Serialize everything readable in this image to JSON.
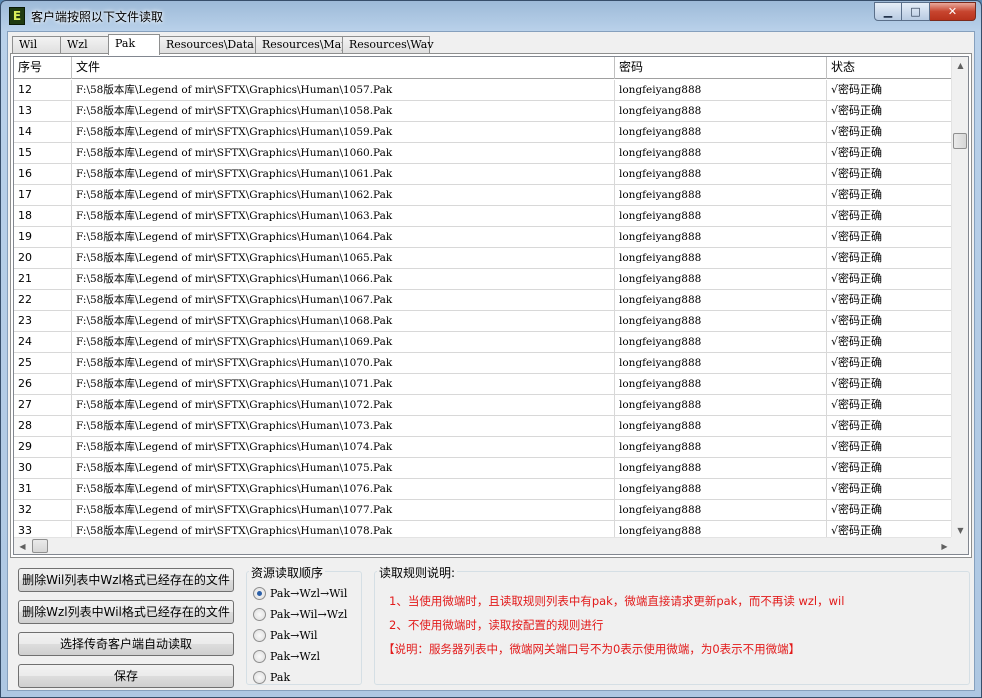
{
  "window": {
    "title": "客户端按照以下文件读取",
    "icon_letter": "E",
    "minimize_glyph": "▁",
    "maximize_glyph": "□",
    "close_glyph": "✕"
  },
  "tabs": [
    {
      "label": "Wil"
    },
    {
      "label": "Wzl"
    },
    {
      "label": "Pak"
    },
    {
      "label": "Resources\\Data"
    },
    {
      "label": "Resources\\Map"
    },
    {
      "label": "Resources\\Wav"
    }
  ],
  "table": {
    "columns": [
      "序号",
      "文件",
      "密码",
      "状态"
    ],
    "rows": [
      {
        "id": "12",
        "file": "F:\\58版本库\\Legend of mir\\SFTX\\Graphics\\Human\\1057.Pak",
        "password": "longfeiyang888",
        "status": "√密码正确"
      },
      {
        "id": "13",
        "file": "F:\\58版本库\\Legend of mir\\SFTX\\Graphics\\Human\\1058.Pak",
        "password": "longfeiyang888",
        "status": "√密码正确"
      },
      {
        "id": "14",
        "file": "F:\\58版本库\\Legend of mir\\SFTX\\Graphics\\Human\\1059.Pak",
        "password": "longfeiyang888",
        "status": "√密码正确"
      },
      {
        "id": "15",
        "file": "F:\\58版本库\\Legend of mir\\SFTX\\Graphics\\Human\\1060.Pak",
        "password": "longfeiyang888",
        "status": "√密码正确"
      },
      {
        "id": "16",
        "file": "F:\\58版本库\\Legend of mir\\SFTX\\Graphics\\Human\\1061.Pak",
        "password": "longfeiyang888",
        "status": "√密码正确"
      },
      {
        "id": "17",
        "file": "F:\\58版本库\\Legend of mir\\SFTX\\Graphics\\Human\\1062.Pak",
        "password": "longfeiyang888",
        "status": "√密码正确"
      },
      {
        "id": "18",
        "file": "F:\\58版本库\\Legend of mir\\SFTX\\Graphics\\Human\\1063.Pak",
        "password": "longfeiyang888",
        "status": "√密码正确"
      },
      {
        "id": "19",
        "file": "F:\\58版本库\\Legend of mir\\SFTX\\Graphics\\Human\\1064.Pak",
        "password": "longfeiyang888",
        "status": "√密码正确"
      },
      {
        "id": "20",
        "file": "F:\\58版本库\\Legend of mir\\SFTX\\Graphics\\Human\\1065.Pak",
        "password": "longfeiyang888",
        "status": "√密码正确"
      },
      {
        "id": "21",
        "file": "F:\\58版本库\\Legend of mir\\SFTX\\Graphics\\Human\\1066.Pak",
        "password": "longfeiyang888",
        "status": "√密码正确"
      },
      {
        "id": "22",
        "file": "F:\\58版本库\\Legend of mir\\SFTX\\Graphics\\Human\\1067.Pak",
        "password": "longfeiyang888",
        "status": "√密码正确"
      },
      {
        "id": "23",
        "file": "F:\\58版本库\\Legend of mir\\SFTX\\Graphics\\Human\\1068.Pak",
        "password": "longfeiyang888",
        "status": "√密码正确"
      },
      {
        "id": "24",
        "file": "F:\\58版本库\\Legend of mir\\SFTX\\Graphics\\Human\\1069.Pak",
        "password": "longfeiyang888",
        "status": "√密码正确"
      },
      {
        "id": "25",
        "file": "F:\\58版本库\\Legend of mir\\SFTX\\Graphics\\Human\\1070.Pak",
        "password": "longfeiyang888",
        "status": "√密码正确"
      },
      {
        "id": "26",
        "file": "F:\\58版本库\\Legend of mir\\SFTX\\Graphics\\Human\\1071.Pak",
        "password": "longfeiyang888",
        "status": "√密码正确"
      },
      {
        "id": "27",
        "file": "F:\\58版本库\\Legend of mir\\SFTX\\Graphics\\Human\\1072.Pak",
        "password": "longfeiyang888",
        "status": "√密码正确"
      },
      {
        "id": "28",
        "file": "F:\\58版本库\\Legend of mir\\SFTX\\Graphics\\Human\\1073.Pak",
        "password": "longfeiyang888",
        "status": "√密码正确"
      },
      {
        "id": "29",
        "file": "F:\\58版本库\\Legend of mir\\SFTX\\Graphics\\Human\\1074.Pak",
        "password": "longfeiyang888",
        "status": "√密码正确"
      },
      {
        "id": "30",
        "file": "F:\\58版本库\\Legend of mir\\SFTX\\Graphics\\Human\\1075.Pak",
        "password": "longfeiyang888",
        "status": "√密码正确"
      },
      {
        "id": "31",
        "file": "F:\\58版本库\\Legend of mir\\SFTX\\Graphics\\Human\\1076.Pak",
        "password": "longfeiyang888",
        "status": "√密码正确"
      },
      {
        "id": "32",
        "file": "F:\\58版本库\\Legend of mir\\SFTX\\Graphics\\Human\\1077.Pak",
        "password": "longfeiyang888",
        "status": "√密码正确"
      },
      {
        "id": "33",
        "file": "F:\\58版本库\\Legend of mir\\SFTX\\Graphics\\Human\\1078.Pak",
        "password": "longfeiyang888",
        "status": "√密码正确"
      }
    ]
  },
  "scroll": {
    "up_glyph": "▲",
    "down_glyph": "▼",
    "left_glyph": "◀",
    "right_glyph": "▶"
  },
  "buttons": {
    "delete_wil": "删除Wil列表中Wzl格式已经存在的文件",
    "delete_wzl": "删除Wzl列表中Wil格式已经存在的文件",
    "auto_read": "选择传奇客户端自动读取",
    "save": "保存"
  },
  "order_group": {
    "title": "资源读取顺序",
    "options": [
      {
        "label": "Pak→Wzl→Wil",
        "checked": true
      },
      {
        "label": "Pak→Wil→Wzl",
        "checked": false
      },
      {
        "label": "Pak→Wil",
        "checked": false
      },
      {
        "label": "Pak→Wzl",
        "checked": false
      },
      {
        "label": "Pak",
        "checked": false
      }
    ]
  },
  "rules_group": {
    "title": "读取规则说明:",
    "lines": [
      "1、当使用微端时，且读取规则列表中有pak，微端直接请求更新pak，而不再读 wzl，wil",
      "2、不使用微端时，读取按配置的规则进行",
      "【说明：服务器列表中，微端网关端口号不为0表示使用微端，为0表示不用微端】"
    ]
  },
  "colors": {
    "rule_text": "#e21a1a",
    "radio_dot": "#2b5fa8"
  }
}
